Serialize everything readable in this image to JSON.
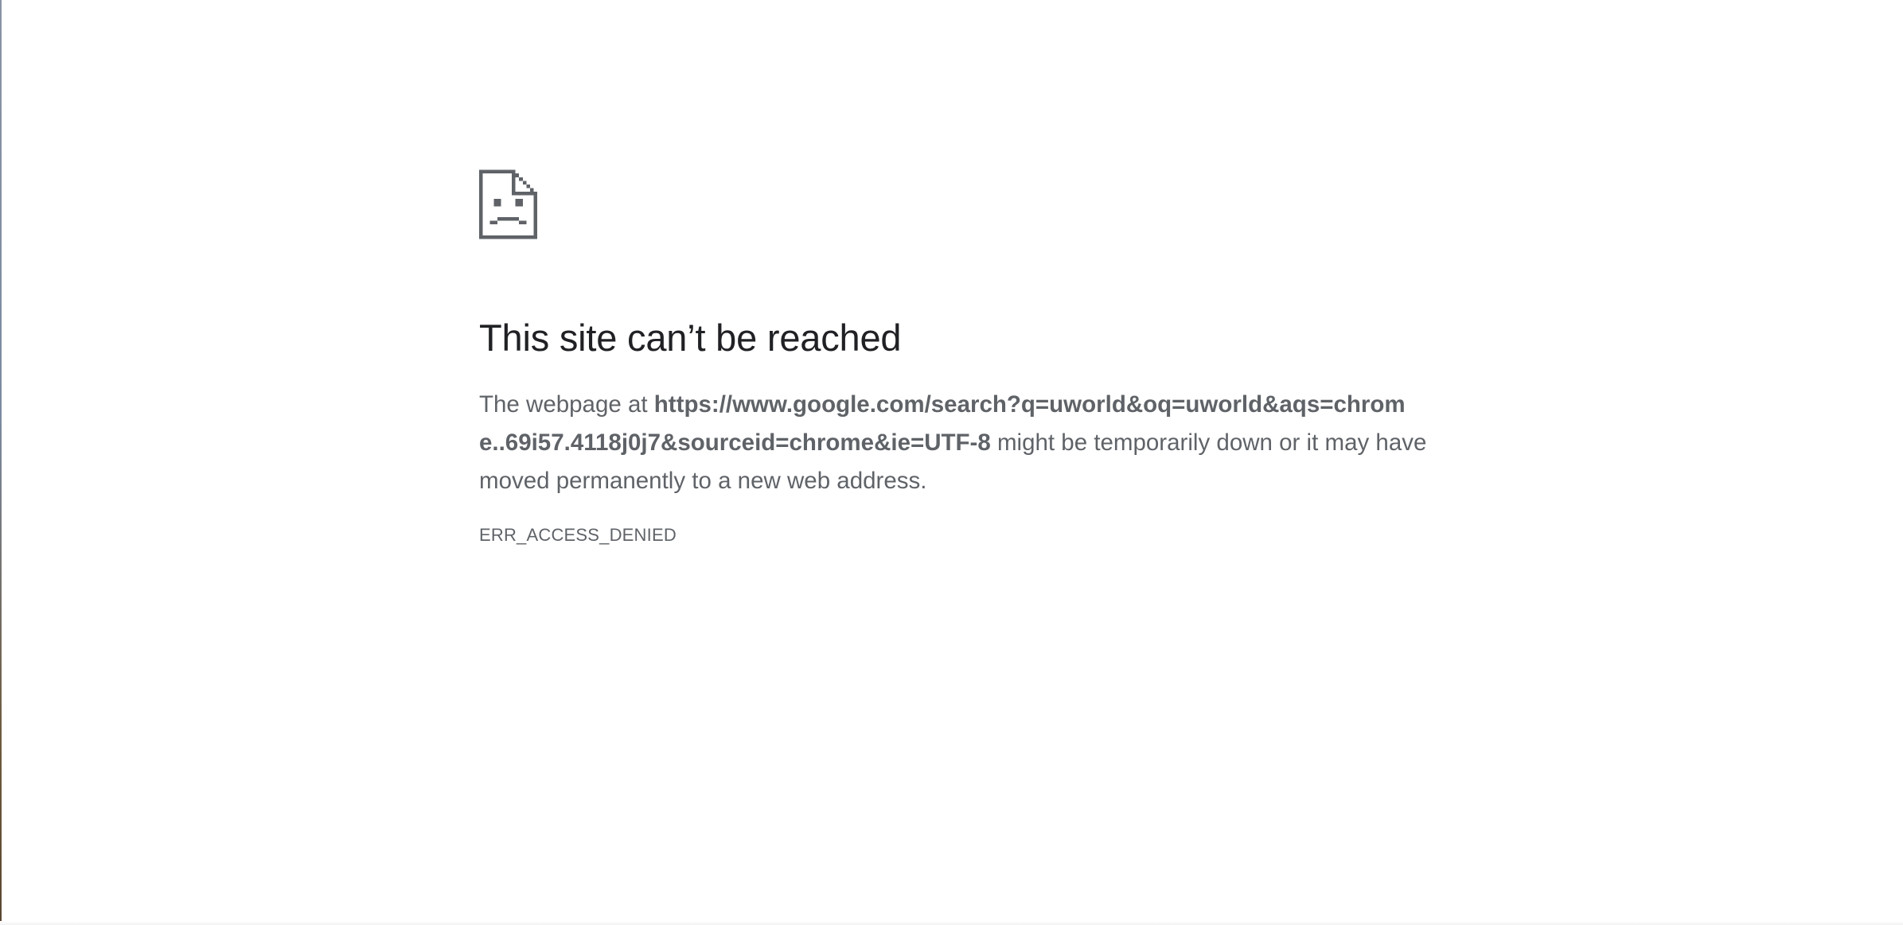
{
  "error_page": {
    "icon": "sad-document-icon",
    "title": "This site can’t be reached",
    "message_prefix": "The webpage at ",
    "url": "https://www.google.com/search?q=uworld&oq=uworld&aqs=chrome..69i57.4118j0j7&sourceid=chrome&ie=UTF-8",
    "message_suffix": " might be temporarily down or it may have moved permanently to a new web address.",
    "error_code": "ERR_ACCESS_DENIED"
  },
  "colors": {
    "icon": "#5f6368",
    "title": "#202124",
    "body_text": "#5f6368",
    "background": "#ffffff"
  }
}
